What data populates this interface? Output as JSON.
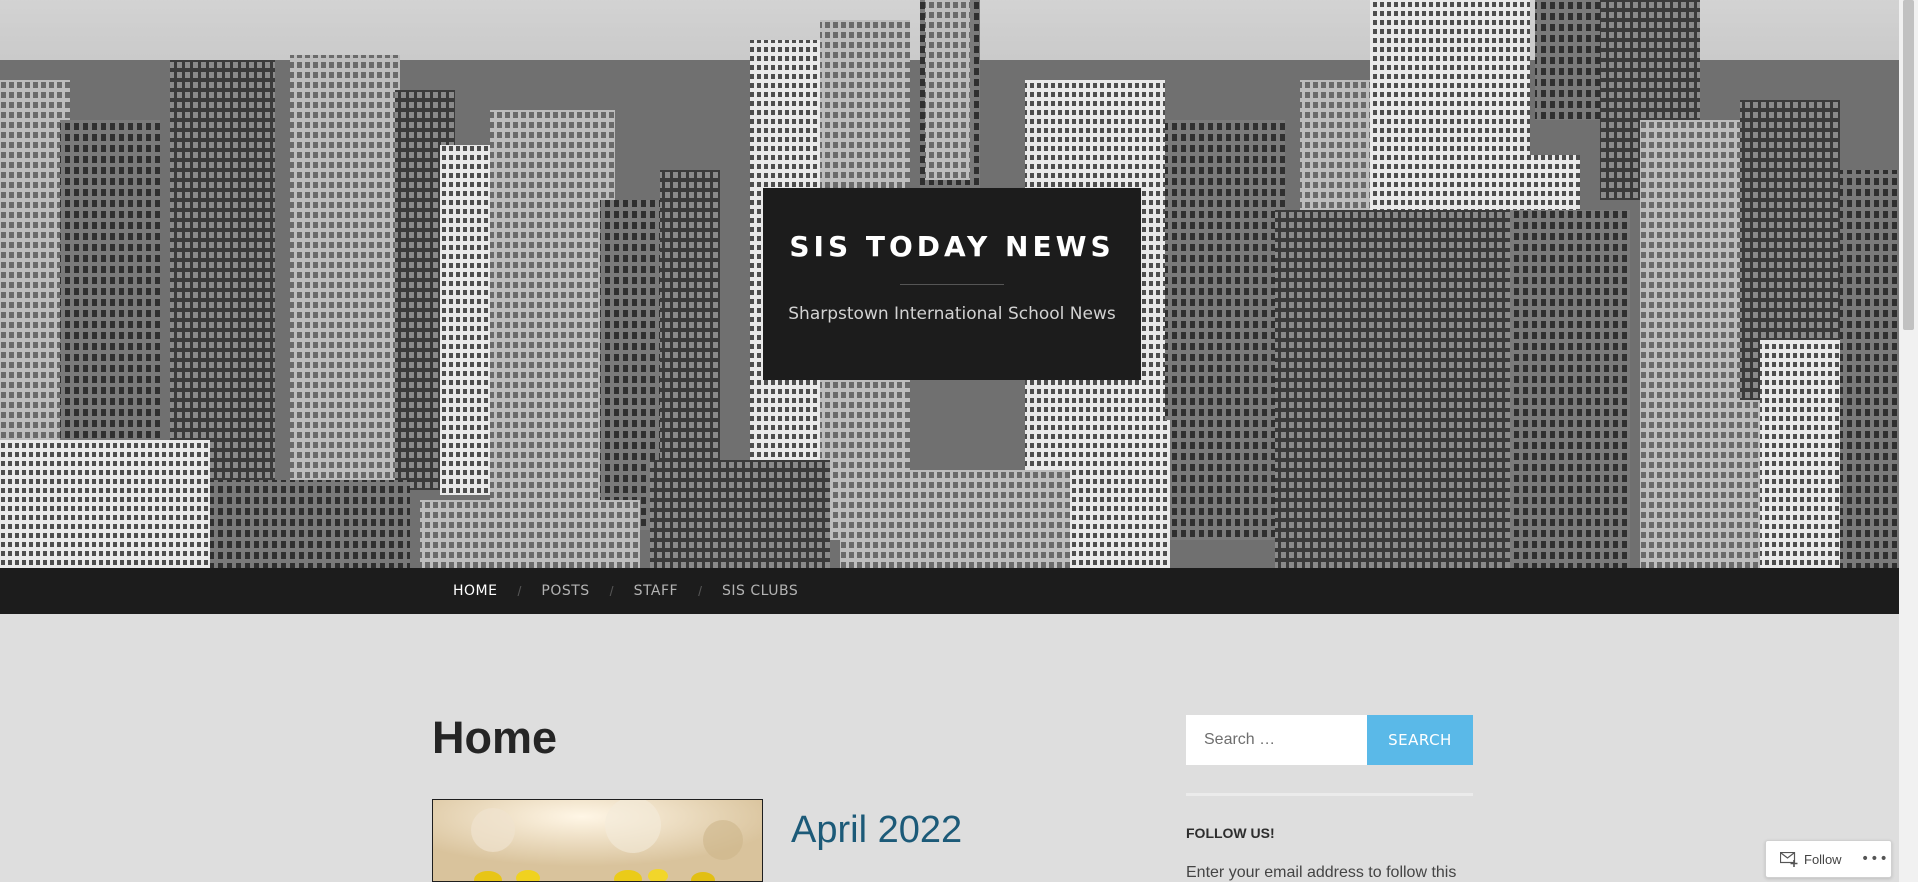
{
  "header": {
    "site_title": "SIS TODAY NEWS",
    "site_description": "Sharpstown International School News"
  },
  "nav": {
    "items": [
      {
        "label": "HOME",
        "active": true
      },
      {
        "label": "POSTS",
        "active": false
      },
      {
        "label": "STAFF",
        "active": false
      },
      {
        "label": "SIS CLUBS",
        "active": false
      }
    ],
    "separator": "/"
  },
  "main": {
    "page_title": "Home",
    "post": {
      "title": "April 2022"
    }
  },
  "sidebar": {
    "search": {
      "placeholder": "Search …",
      "button_label": "SEARCH"
    },
    "follow_widget": {
      "title": "FOLLOW US!",
      "text": "Enter your email address to follow this"
    }
  },
  "follow_bar": {
    "label": "Follow",
    "more": "•••"
  },
  "colors": {
    "header_bg": "#1c1c1c",
    "accent": "#5ab9e8",
    "link": "#1c5a78",
    "page_bg": "#dedede"
  },
  "icons": [
    "city-skyline-header-image",
    "follow-icon",
    "more-icon"
  ]
}
